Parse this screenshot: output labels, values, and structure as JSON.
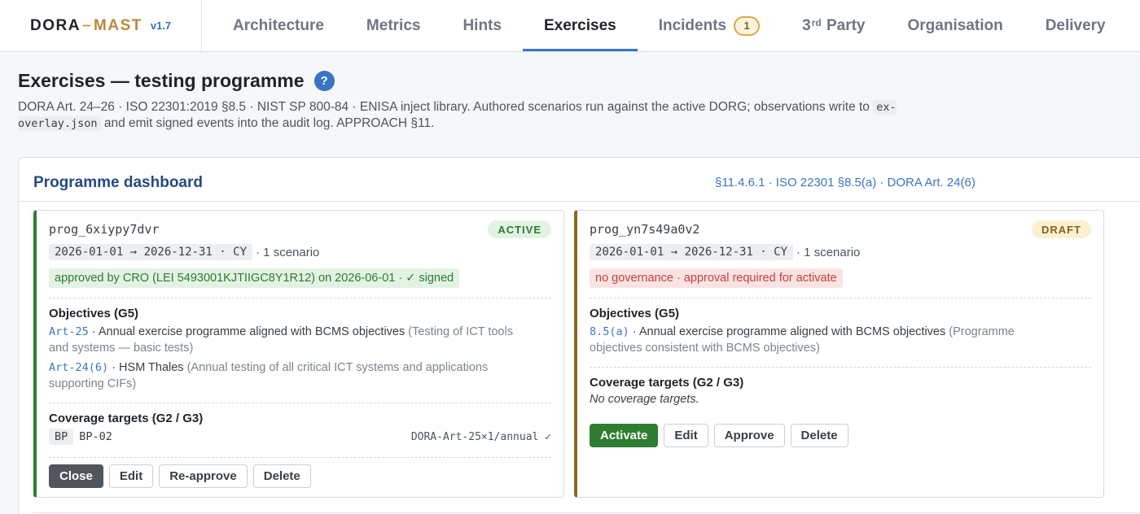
{
  "brand": {
    "part1": "DORA",
    "sep": "–",
    "part2": "MAST",
    "version": "v1.7"
  },
  "nav": {
    "architecture": "Architecture",
    "metrics": "Metrics",
    "hints": "Hints",
    "exercises": "Exercises",
    "incidents": "Incidents",
    "incidents_count": "1",
    "third_num": "3",
    "third_sup": "rd",
    "third_label": "Party",
    "organisation": "Organisation",
    "delivery": "Delivery"
  },
  "header": {
    "title": "Exercises — testing programme",
    "help": "?",
    "subtitle_a": "DORA Art. 24–26 · ISO 22301:2019 §8.5 · NIST SP 800-84 · ENISA inject library. Authored scenarios run against the active DORG; observations write to",
    "subtitle_code": "ex-overlay.json",
    "subtitle_b": "and emit signed events into the audit log. APPROACH §11."
  },
  "dashboard": {
    "title": "Programme dashboard",
    "refs": "§11.4.6.1 · ISO 22301 §8.5(a) · DORA Art. 24(6)"
  },
  "programmes": [
    {
      "id": "prog_6xiypy7dvr",
      "status": "ACTIVE",
      "range": "2026-01-01 → 2026-12-31 · CY",
      "scenarios": "· 1 scenario",
      "governance": "approved by CRO (LEI 5493001KJTIIGC8Y1R12) on 2026-06-01 · ✓ signed",
      "objectives_heading": "Objectives (G5)",
      "objectives": [
        {
          "ref": "Art-25",
          "text": "· Annual exercise programme aligned with BCMS objectives",
          "note": "(Testing of ICT tools and systems — basic tests)"
        },
        {
          "ref": "Art-24(6)",
          "text": "· HSM Thales",
          "note": "(Annual testing of all critical ICT systems and applications supporting CIFs)"
        }
      ],
      "coverage_heading": "Coverage targets (G2 / G3)",
      "coverage": {
        "tag": "BP",
        "value": "BP-02",
        "right": "DORA-Art-25×1/annual ✓"
      },
      "actions": {
        "close": "Close",
        "edit": "Edit",
        "reapprove": "Re-approve",
        "delete": "Delete"
      }
    },
    {
      "id": "prog_yn7s49a0v2",
      "status": "DRAFT",
      "range": "2026-01-01 → 2026-12-31 · CY",
      "scenarios": "· 1 scenario",
      "governance": "no governance · approval required for activate",
      "objectives_heading": "Objectives (G5)",
      "objectives": [
        {
          "ref": "8.5(a)",
          "text": "· Annual exercise programme aligned with BCMS objectives",
          "note": "(Programme objectives consistent with BCMS objectives)"
        }
      ],
      "coverage_heading": "Coverage targets (G2 / G3)",
      "coverage_empty": "No coverage targets.",
      "actions": {
        "activate": "Activate",
        "edit": "Edit",
        "approve": "Approve",
        "delete": "Delete"
      }
    }
  ],
  "colors": {
    "accent": "#3b74c4",
    "active": "#2f7d32",
    "draft": "#8a6a1f",
    "brand_gold": "#b8893a"
  }
}
